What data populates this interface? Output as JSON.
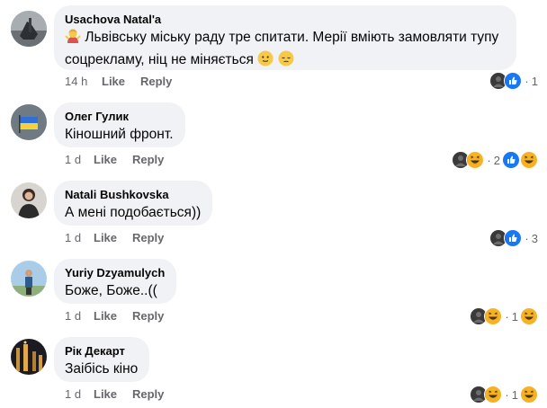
{
  "comments": [
    {
      "author": "Usachova Natal'a",
      "text_line1": "Львівську міську раду тре спитати. Мерії вміють замовляти тупу",
      "text_line2": "соцрекламу, ніц не міняється",
      "time": "14 h",
      "like": "Like",
      "reply": "Reply",
      "reaction_count": "1",
      "reactions": [
        "dark-avatar-icon",
        "like-icon"
      ],
      "avatar": "gray-avatar"
    },
    {
      "author": "Олег Гулик",
      "text": "Кіношний фронт.",
      "time": "1 d",
      "like": "Like",
      "reply": "Reply",
      "reaction_count": "2",
      "reactions": [
        "dark-avatar-icon",
        "laugh-icon"
      ],
      "trailing_reaction": "like-icon",
      "avatar": "ukraine-flag-avatar"
    },
    {
      "author": "Natali Bushkovska",
      "text": "А мені подобається))",
      "time": "1 d",
      "like": "Like",
      "reply": "Reply",
      "reaction_count": "3",
      "reactions": [
        "dark-avatar-icon",
        "like-icon"
      ],
      "avatar": "woman-avatar"
    },
    {
      "author": "Yuriy Dzyamulych",
      "text": "Боже, Боже..((",
      "time": "1 d",
      "like": "Like",
      "reply": "Reply",
      "reaction_count": "1",
      "reactions": [
        "dark-avatar-icon",
        "laugh-icon"
      ],
      "trailing_reaction": "laugh-icon",
      "avatar": "man-avatar"
    },
    {
      "author": "Рік Декарт",
      "text": "Заібісь кіно",
      "time": "1 d",
      "like": "Like",
      "reply": "Reply",
      "reaction_count": "1",
      "reactions": [
        "dark-avatar-icon",
        "laugh-icon"
      ],
      "trailing_reaction": "laugh-icon",
      "avatar": "night-city-avatar"
    }
  ],
  "colors": {
    "bubble": "#f0f2f5",
    "secondary_text": "#65676b",
    "like_blue": "#1877f2",
    "laugh_yellow": "#f7b125"
  }
}
